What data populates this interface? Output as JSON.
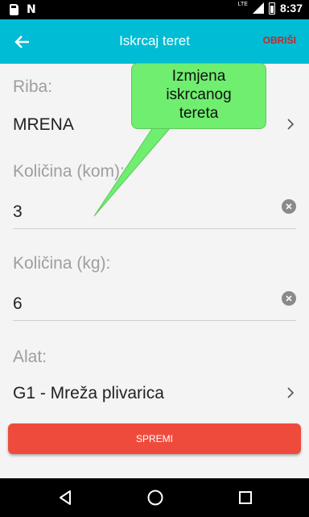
{
  "status_bar": {
    "network": "LTE",
    "time": "8:37"
  },
  "app_bar": {
    "title": "Iskrcaj teret",
    "delete_label": "OBRIŠI"
  },
  "fields": {
    "fish": {
      "label": "Riba:",
      "value": "MRENA"
    },
    "quantity_pcs": {
      "label": "Količina (kom):",
      "value": "3"
    },
    "quantity_kg": {
      "label": "Količina (kg):",
      "value": "6"
    },
    "tool": {
      "label": "Alat:",
      "value": "G1 - Mreža plivarica"
    }
  },
  "save_label": "SPREMI",
  "tooltip": {
    "line1": "Izmjena",
    "line2": "iskrcanog",
    "line3": "tereta"
  },
  "colors": {
    "app_bar": "#00bcd4",
    "delete": "#c62828",
    "save_button": "#ef4b3c",
    "tooltip": "#70ee70"
  }
}
